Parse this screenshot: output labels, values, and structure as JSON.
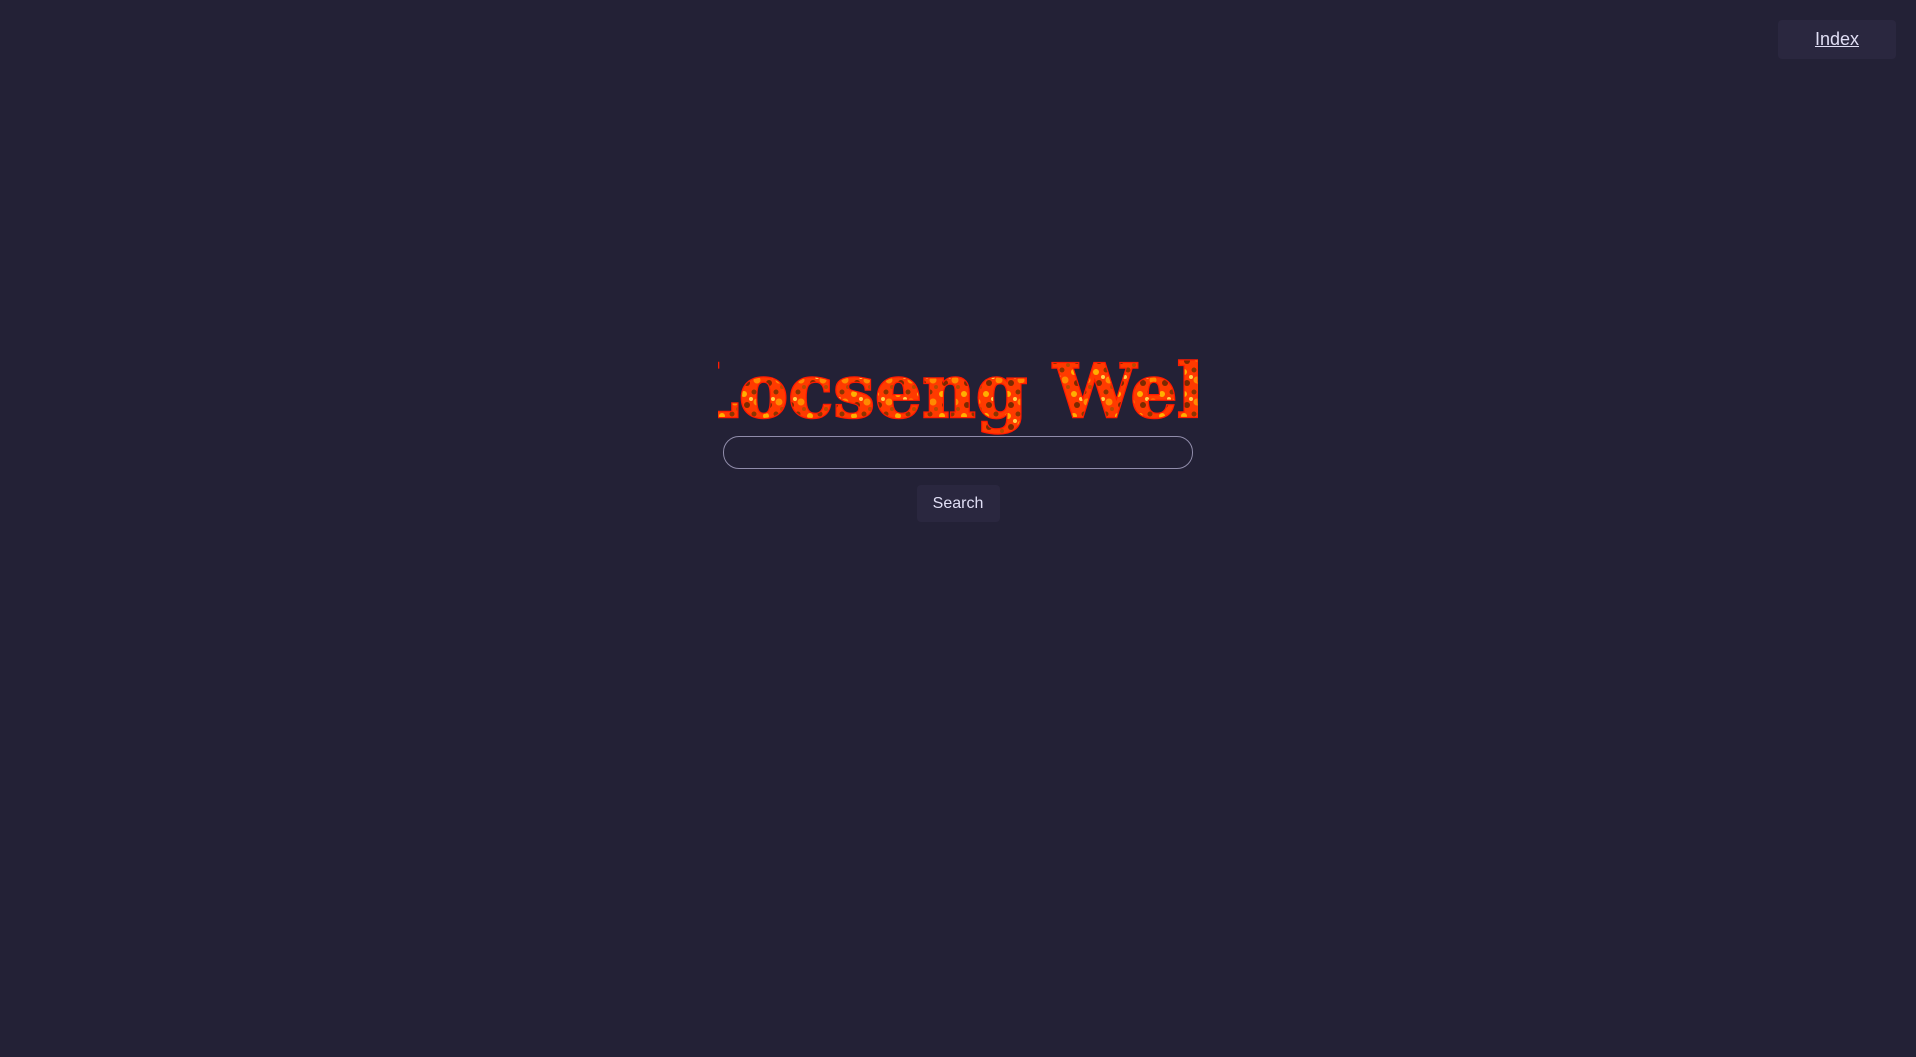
{
  "nav": {
    "index_label": "Index"
  },
  "logo": {
    "text": "Locseng Web",
    "fire_colors": [
      "#ff1a00",
      "#ff6a00",
      "#ffb000",
      "#6b2a00"
    ]
  },
  "search": {
    "value": "",
    "placeholder": "",
    "button_label": "Search"
  },
  "colors": {
    "background": "#232136",
    "surface": "#2a273f",
    "text": "#e0def4",
    "input_border": "#908caa"
  }
}
